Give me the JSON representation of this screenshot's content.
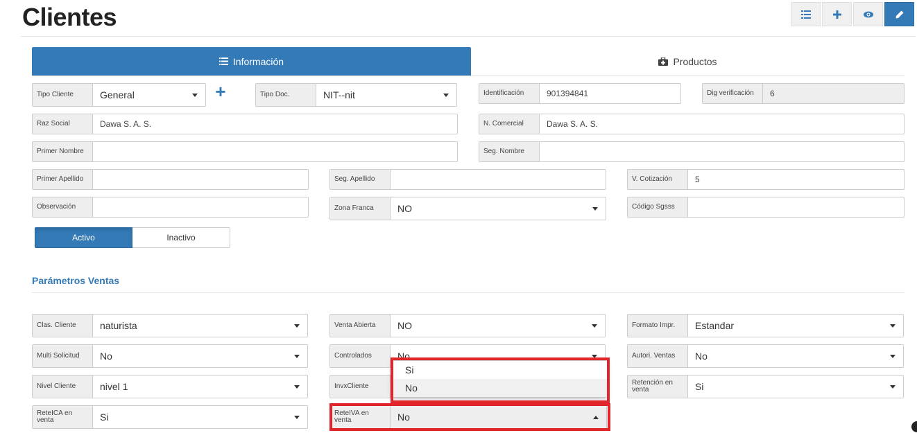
{
  "page": {
    "title": "Clientes"
  },
  "toolbar": {
    "buttons": [
      "list-icon",
      "plus-icon",
      "eye-icon",
      "pencil-icon"
    ]
  },
  "tabs": [
    {
      "label": "Información",
      "icon": "list-icon",
      "active": true
    },
    {
      "label": "Productos",
      "icon": "medkit-icon",
      "active": false
    }
  ],
  "form": {
    "tipo_cliente": {
      "label": "Tipo Cliente",
      "value": "General"
    },
    "tipo_doc": {
      "label": "Tipo Doc.",
      "value": "NIT--nit"
    },
    "identificacion": {
      "label": "Identificación",
      "value": "901394841"
    },
    "dig_verificacion": {
      "label": "Dig verificación",
      "value": "6"
    },
    "razon_social": {
      "label": "Raz Social",
      "value": "Dawa S. A. S."
    },
    "n_comercial": {
      "label": "N. Comercial",
      "value": "Dawa S. A. S."
    },
    "primer_nombre": {
      "label": "Primer Nombre",
      "value": ""
    },
    "seg_nombre": {
      "label": "Seg. Nombre",
      "value": ""
    },
    "primer_apellido": {
      "label": "Primer Apellido",
      "value": ""
    },
    "seg_apellido": {
      "label": "Seg. Apellido",
      "value": ""
    },
    "v_cotizacion": {
      "label": "V. Cotización",
      "value": "5"
    },
    "observacion": {
      "label": "Observación",
      "value": ""
    },
    "zona_franca": {
      "label": "Zona Franca",
      "value": "NO"
    },
    "codigo_sgsss": {
      "label": "Código Sgsss",
      "value": ""
    }
  },
  "status_toggle": {
    "active_label": "Activo",
    "inactive_label": "Inactivo",
    "selected": "Activo"
  },
  "ventas": {
    "section_title": "Parámetros Ventas",
    "clas_cliente": {
      "label": "Clas. Cliente",
      "value": "naturista"
    },
    "venta_abierta": {
      "label": "Venta Abierta",
      "value": "NO"
    },
    "formato_impr": {
      "label": "Formato Impr.",
      "value": "Estandar"
    },
    "multi_solicitud": {
      "label": "Multi Solicitud",
      "value": "No"
    },
    "controlados": {
      "label": "Controlados",
      "value": "No"
    },
    "autori_ventas": {
      "label": "Autori. Ventas",
      "value": "No"
    },
    "nivel_cliente": {
      "label": "Nivel Cliente",
      "value": "nivel 1"
    },
    "invx_cliente": {
      "label": "InvxCliente",
      "value": ""
    },
    "retencion_venta": {
      "label": "Retención en venta",
      "value": "Si"
    },
    "reteica_venta": {
      "label": "ReteICA en venta",
      "value": "Si"
    },
    "reteiva_venta": {
      "label": "ReteIVA en venta",
      "value": "No"
    }
  },
  "reteiva_dropdown": {
    "options": [
      "Si",
      "No"
    ],
    "highlighted": "No"
  },
  "colors": {
    "primary": "#337ab7",
    "highlight_box": "#e0262b"
  }
}
